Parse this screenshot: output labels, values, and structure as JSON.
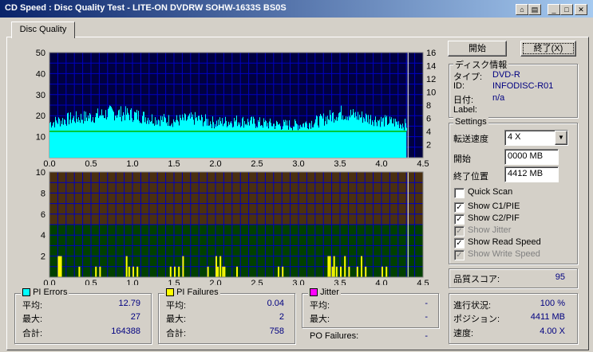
{
  "window": {
    "title": "CD Speed : Disc Quality Test - LITE-ON DVDRW SOHW-1633S BS0S"
  },
  "tabs": [
    {
      "label": "Disc Quality"
    }
  ],
  "buttons": {
    "start": "開始",
    "exit": "終了(X)"
  },
  "disc_info": {
    "group": "ディスク情報",
    "type_label": "タイプ:",
    "type_value": "DVD-R",
    "id_label": "ID:",
    "id_value": "INFODISC-R01",
    "date_label": "日付:",
    "date_value": "n/a",
    "label_label": "Label:",
    "label_value": ""
  },
  "settings": {
    "group": "Settings",
    "speed_label": "転送速度",
    "speed_value": "4 X",
    "start_label": "開始",
    "start_value": "0000 MB",
    "end_label": "終了位置",
    "end_value": "4412 MB",
    "quick_scan": "Quick Scan",
    "show_c1": "Show C1/PIE",
    "show_c2": "Show C2/PIF",
    "show_jitter": "Show Jitter",
    "show_read": "Show Read Speed",
    "show_write": "Show Write Speed"
  },
  "quality": {
    "label": "品質スコア:",
    "value": "95"
  },
  "progress": {
    "progress_label": "進行状況:",
    "progress_value": "100 %",
    "position_label": "ポジション:",
    "position_value": "4411 MB",
    "speed_label": "速度:",
    "speed_value": "4.00 X"
  },
  "pi_errors": {
    "group": "PI Errors",
    "avg_label": "平均:",
    "avg": "12.79",
    "max_label": "最大:",
    "max": "27",
    "total_label": "合計:",
    "total": "164388"
  },
  "pi_failures": {
    "group": "PI Failures",
    "avg_label": "平均:",
    "avg": "0.04",
    "max_label": "最大:",
    "max": "2",
    "total_label": "合計:",
    "total": "758"
  },
  "jitter": {
    "group": "Jitter",
    "avg_label": "平均:",
    "avg": "-",
    "max_label": "最大:",
    "max": "-"
  },
  "po_failures": {
    "label": "PO Failures:",
    "value": "-"
  },
  "colors": {
    "pi_errors": "#00ffff",
    "pi_failures": "#ffff00",
    "jitter": "#ff00ff",
    "read_speed": "#00c000"
  },
  "chart_data": [
    {
      "type": "area",
      "x_ticks": [
        "0.0",
        "0.5",
        "1.0",
        "1.5",
        "2.0",
        "2.5",
        "3.0",
        "3.5",
        "4.0",
        "4.5"
      ],
      "y_left_ticks": [
        "10",
        "20",
        "30",
        "40",
        "50"
      ],
      "y_right_ticks": [
        "2",
        "4",
        "6",
        "8",
        "10",
        "12",
        "14",
        "16"
      ],
      "xlim": [
        0,
        4.5
      ],
      "ylim": [
        0,
        50
      ],
      "y2lim": [
        0,
        16
      ],
      "series": [
        {
          "values_x": [
            0.0,
            0.25,
            0.5,
            0.75,
            1.0,
            1.25,
            1.5,
            1.75,
            2.0,
            2.25,
            2.5,
            2.75,
            3.0,
            3.25,
            3.5,
            3.75,
            4.0,
            4.2,
            4.3
          ],
          "values_y": [
            17,
            19,
            20,
            22,
            21,
            19,
            18,
            19,
            17,
            18,
            17,
            16,
            16,
            18,
            22,
            20,
            18,
            17,
            16
          ]
        },
        {
          "values_x": [
            0.0,
            4.3
          ],
          "values_y": [
            4.0,
            4.0
          ]
        }
      ]
    },
    {
      "type": "bar",
      "x_ticks": [
        "0.0",
        "0.5",
        "1.0",
        "1.5",
        "2.0",
        "2.5",
        "3.0",
        "3.5",
        "4.0",
        "4.5"
      ],
      "y_ticks": [
        "2",
        "4",
        "6",
        "8",
        "10"
      ],
      "xlim": [
        0,
        4.5
      ],
      "ylim": [
        0,
        10
      ],
      "series": [
        {
          "x": [
            0.1,
            0.11,
            0.12,
            0.13,
            0.35,
            0.55,
            0.6,
            0.92,
            0.95,
            1.0,
            1.05,
            1.45,
            1.5,
            1.55,
            1.6,
            1.9,
            2.0,
            2.02,
            2.05,
            2.08,
            2.1,
            2.25,
            2.75,
            2.8,
            3.35,
            3.37,
            3.4,
            3.42,
            3.45,
            3.5,
            3.55,
            3.6,
            3.7,
            3.75,
            3.8,
            4.0,
            4.05
          ],
          "y": [
            2,
            2,
            1,
            2,
            1,
            1,
            1,
            2,
            1,
            1,
            1,
            1,
            1,
            1,
            2,
            1,
            2,
            1,
            2,
            1,
            1,
            1,
            1,
            1,
            2,
            2,
            1,
            2,
            1,
            1,
            2,
            1,
            1,
            2,
            1,
            1,
            1
          ]
        }
      ]
    }
  ]
}
